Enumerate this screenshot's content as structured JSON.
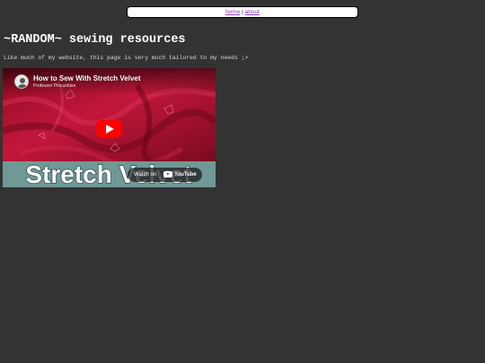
{
  "nav": {
    "home_label": "home",
    "separator": "|",
    "about_label": "about"
  },
  "page": {
    "title": "~RANDOM~ sewing resources",
    "intro": "Like much of my website, this page is very much tailored to my needs ;>"
  },
  "video": {
    "title": "How to Sew With Stretch Velvet",
    "channel": "Professor Pincushion",
    "overlay_text": "Stretch Velvet",
    "watch_on_label": "Watch on",
    "youtube_label": "YouTube",
    "play_icon": "play-icon"
  },
  "colors": {
    "background": "#333333",
    "link": "#8a3dbf",
    "play_button": "#ff0000",
    "velvet": "#b5132f"
  }
}
